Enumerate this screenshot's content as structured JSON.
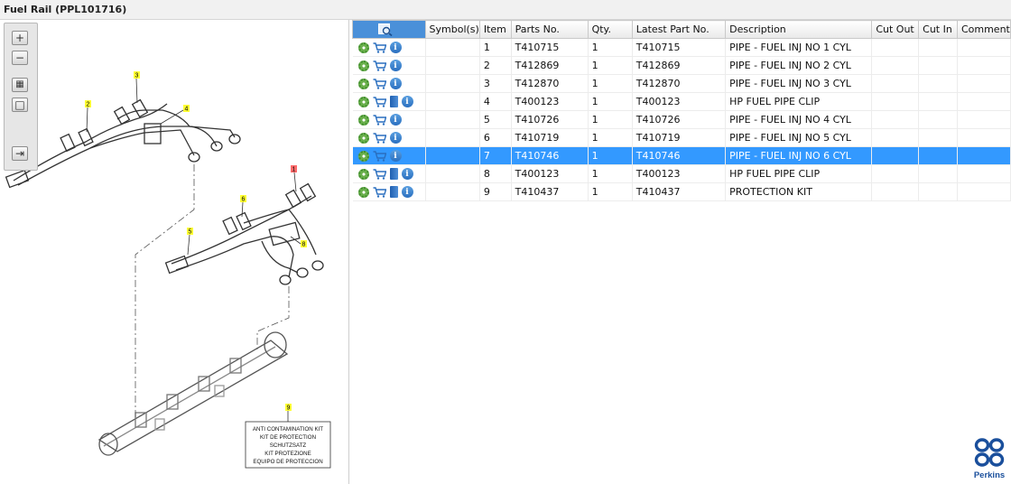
{
  "window": {
    "title": "Fuel Rail (PPL101716)"
  },
  "diagram": {
    "callouts": [
      "1",
      "2",
      "3",
      "4",
      "5",
      "6",
      "7",
      "8",
      "9"
    ],
    "kit_label_lines": [
      "ANTI CONTAMINATION KIT",
      "KIT DE PROTECTION",
      "SCHUTZSATZ",
      "KIT PROTEZIONE",
      "EQUIPO DE PROTECCION"
    ]
  },
  "toolbar": {
    "zoom_in": "+",
    "zoom_out": "−",
    "fit": "▦",
    "actual": "□",
    "export": "⇥"
  },
  "table": {
    "columns": [
      "Symbol(s)",
      "Item",
      "Parts No.",
      "Qty.",
      "Latest Part No.",
      "Description",
      "Cut Out",
      "Cut In",
      "Comment"
    ],
    "rows": [
      {
        "item": "1",
        "part": "T410715",
        "qty": "1",
        "latest": "T410715",
        "desc": "PIPE - FUEL INJ NO 1 CYL",
        "book": false,
        "selected": false
      },
      {
        "item": "2",
        "part": "T412869",
        "qty": "1",
        "latest": "T412869",
        "desc": "PIPE - FUEL INJ NO 2 CYL",
        "book": false,
        "selected": false
      },
      {
        "item": "3",
        "part": "T412870",
        "qty": "1",
        "latest": "T412870",
        "desc": "PIPE - FUEL INJ NO 3 CYL",
        "book": false,
        "selected": false
      },
      {
        "item": "4",
        "part": "T400123",
        "qty": "1",
        "latest": "T400123",
        "desc": "HP FUEL PIPE CLIP",
        "book": true,
        "selected": false
      },
      {
        "item": "5",
        "part": "T410726",
        "qty": "1",
        "latest": "T410726",
        "desc": "PIPE - FUEL INJ NO 4 CYL",
        "book": false,
        "selected": false
      },
      {
        "item": "6",
        "part": "T410719",
        "qty": "1",
        "latest": "T410719",
        "desc": "PIPE - FUEL INJ NO 5 CYL",
        "book": false,
        "selected": false
      },
      {
        "item": "7",
        "part": "T410746",
        "qty": "1",
        "latest": "T410746",
        "desc": "PIPE - FUEL INJ NO 6 CYL",
        "book": false,
        "selected": true
      },
      {
        "item": "8",
        "part": "T400123",
        "qty": "1",
        "latest": "T400123",
        "desc": "HP FUEL PIPE CLIP",
        "book": true,
        "selected": false
      },
      {
        "item": "9",
        "part": "T410437",
        "qty": "1",
        "latest": "T410437",
        "desc": "PROTECTION KIT",
        "book": true,
        "selected": false
      }
    ]
  },
  "brand": {
    "name": "Perkins",
    "color": "#1a4f9c"
  }
}
